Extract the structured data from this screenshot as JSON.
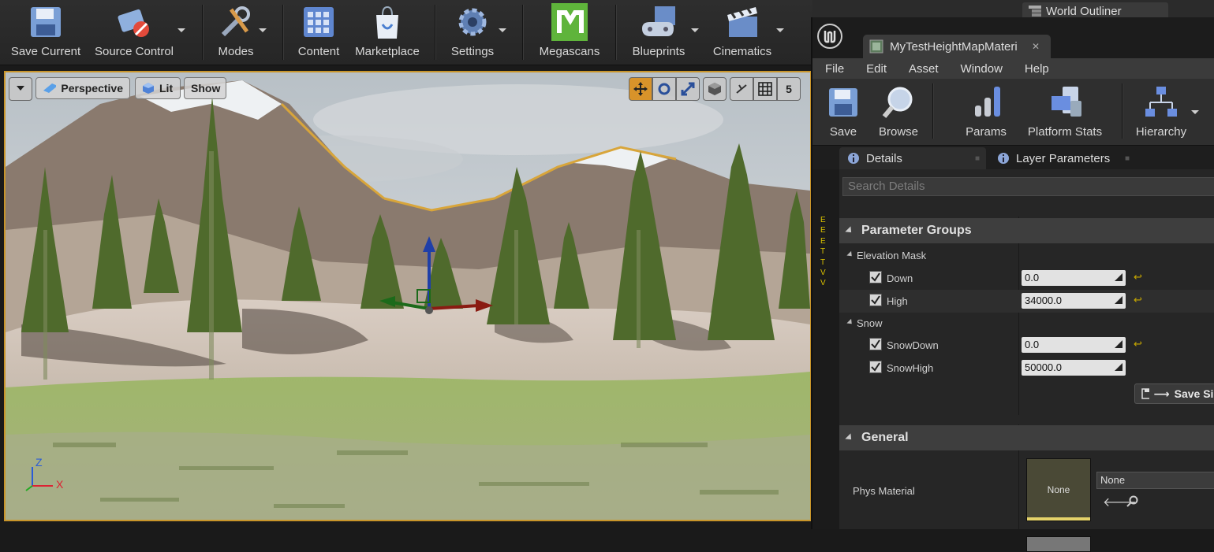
{
  "toolbar": {
    "buttons": [
      {
        "label": "Save Current",
        "icon": "floppy-disk-icon"
      },
      {
        "label": "Source Control",
        "icon": "source-control-icon"
      },
      {
        "label": "Modes",
        "icon": "modes-tools-icon"
      },
      {
        "label": "Content",
        "icon": "content-grid-icon"
      },
      {
        "label": "Marketplace",
        "icon": "marketplace-bag-icon"
      },
      {
        "label": "Settings",
        "icon": "settings-gear-icon"
      },
      {
        "label": "Megascans",
        "icon": "megascans-m-icon"
      },
      {
        "label": "Blueprints",
        "icon": "blueprints-gamepad-icon"
      },
      {
        "label": "Cinematics",
        "icon": "clapperboard-icon"
      }
    ]
  },
  "viewport": {
    "view_mode": "Perspective",
    "lighting": "Lit",
    "show": "Show",
    "camera_speed": "5",
    "axis": {
      "z": "Z",
      "x": "X"
    }
  },
  "background_tabs": {
    "world_outliner": "World Outliner"
  },
  "material_editor": {
    "document_tab": "MyTestHeightMapMateri",
    "menu": [
      "File",
      "Edit",
      "Asset",
      "Window",
      "Help"
    ],
    "toolbar": {
      "save": "Save",
      "browse": "Browse",
      "params": "Params",
      "platform_stats": "Platform Stats",
      "hierarchy": "Hierarchy"
    },
    "tabs": {
      "details": "Details",
      "layer_parameters": "Layer Parameters"
    },
    "search_placeholder": "Search Details",
    "parameter_groups": {
      "title": "Parameter Groups",
      "elevation_mask": {
        "title": "Elevation Mask",
        "down": {
          "name": "Down",
          "value": "0.0",
          "checked": true
        },
        "high": {
          "name": "High",
          "value": "34000.0",
          "checked": true
        }
      },
      "snow": {
        "title": "Snow",
        "snow_down": {
          "name": "SnowDown",
          "value": "0.0",
          "checked": true
        },
        "snow_high": {
          "name": "SnowHigh",
          "value": "50000.0",
          "checked": true
        }
      },
      "save_sibling": "Save Sib"
    },
    "general": {
      "title": "General",
      "phys_material_label": "Phys Material",
      "phys_material_thumb": "None",
      "phys_material_value": "None"
    },
    "gutter_letters": "E\nE\nE\nT\nT\nV\nV"
  },
  "colors": {
    "accent_orange": "#c9952a",
    "reset_arrow": "#c8a800",
    "megascans_green": "#5fb43b"
  }
}
